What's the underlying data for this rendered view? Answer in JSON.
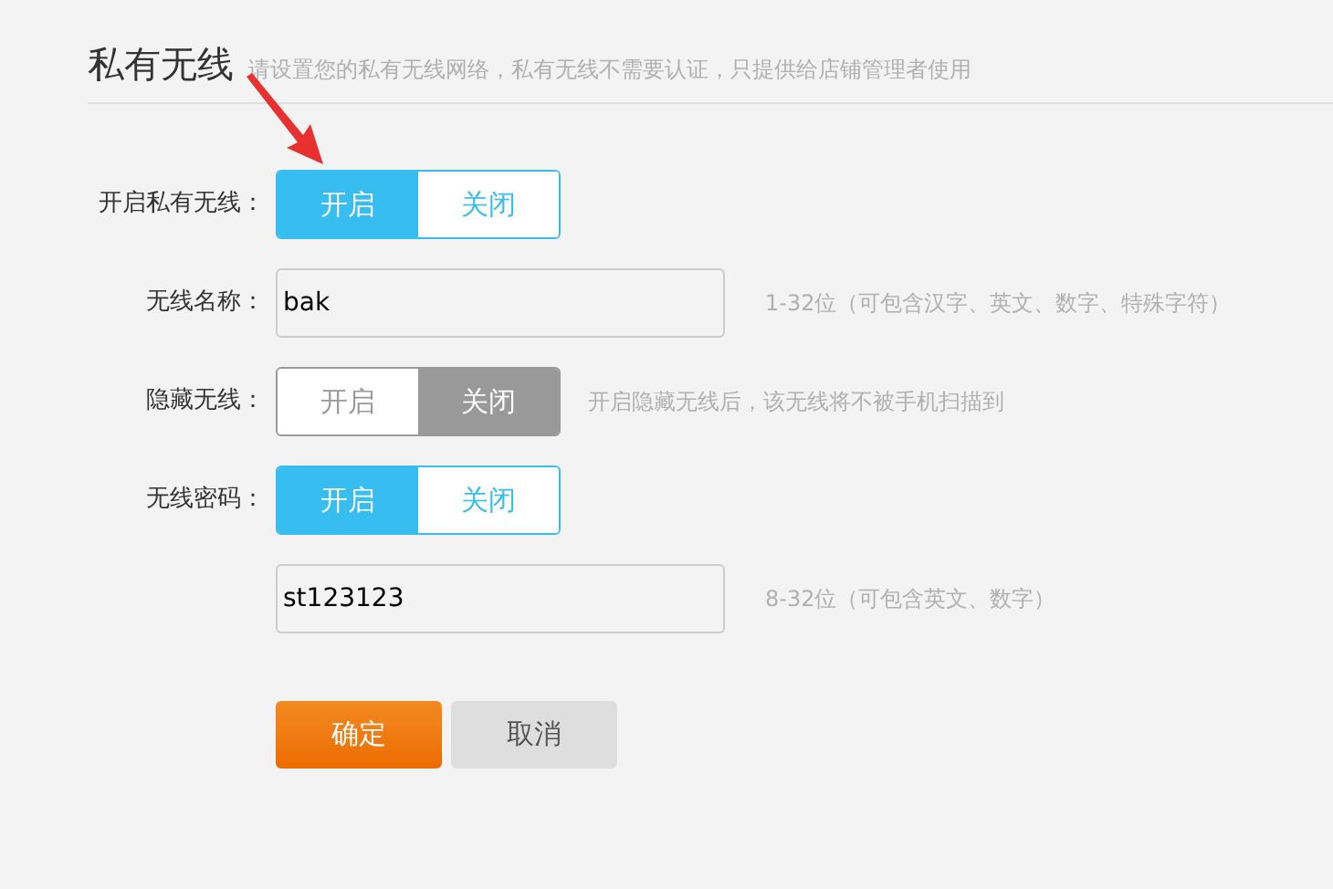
{
  "header": {
    "title": "私有无线",
    "description": "请设置您的私有无线网络，私有无线不需要认证，只提供给店铺管理者使用"
  },
  "annotation": {
    "kind": "arrow"
  },
  "rows": [
    {
      "kind": "toggle",
      "label": "开启私有无线：",
      "options": [
        {
          "label": "开启",
          "selected": true
        },
        {
          "label": "关闭",
          "selected": false
        }
      ]
    },
    {
      "kind": "input",
      "label": "无线名称：",
      "value": "bak",
      "hint": "1-32位（可包含汉字、英文、数字、特殊字符）"
    },
    {
      "kind": "toggle",
      "label": "隐藏无线：",
      "options": [
        {
          "label": "开启",
          "selected": false
        },
        {
          "label": "关闭",
          "selected": true
        }
      ],
      "hint": "开启隐藏无线后，该无线将不被手机扫描到"
    },
    {
      "kind": "toggle",
      "label": "无线密码：",
      "options": [
        {
          "label": "开启",
          "selected": true
        },
        {
          "label": "关闭",
          "selected": false
        }
      ]
    },
    {
      "kind": "input",
      "value": "st123123",
      "hint": "8-32位（可包含英文、数字）"
    }
  ],
  "buttons": [
    {
      "label": "确定",
      "kind": "primary"
    },
    {
      "label": "取消",
      "kind": "secondary"
    }
  ]
}
